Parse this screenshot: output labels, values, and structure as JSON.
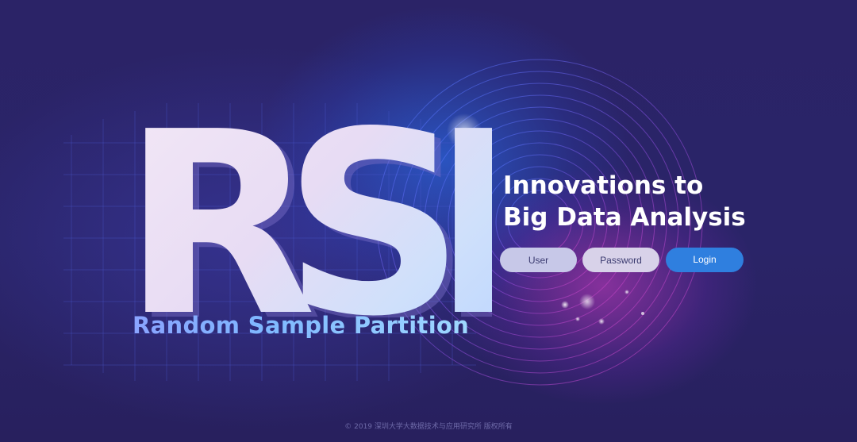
{
  "brand": {
    "logo_text": "RSP",
    "subtitle": "Random Sample Partition"
  },
  "headline": {
    "line1": "Innovations to",
    "line2": "Big Data Analysis"
  },
  "login_form": {
    "user_placeholder": "User",
    "password_placeholder": "Password",
    "login_label": "Login"
  },
  "footer": {
    "copyright": "© 2019 深圳大学大数据技术与应用研究所 版权所有"
  },
  "colors": {
    "background": "#2a2266",
    "login_button": "#2f7fdf",
    "accent_blue": "#2f7cff",
    "accent_magenta": "#d23cc8"
  }
}
